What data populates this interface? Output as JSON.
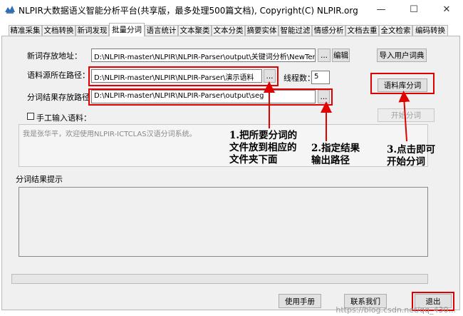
{
  "window": {
    "title": "NLPIR大数据语义智能分析平台(共享版，最多处理500篇文档), Copyright(C) NLPIR.org",
    "minimize": "—",
    "restore": "☐",
    "close": "✕"
  },
  "tabs": [
    "精准采集",
    "文档转换",
    "新词发现",
    "批量分词",
    "语言统计",
    "文本聚类",
    "文本分类",
    "摘要实体",
    "智能过滤",
    "情感分析",
    "文档去重",
    "全文检索",
    "编码转换"
  ],
  "form": {
    "newword_label": "新词存放地址：",
    "newword_path": "D:\\NLPIR-master\\NLPIR\\NLPIR-Parser\\output\\关键词分析\\NewTermlist.txt",
    "browse": "...",
    "edit_button": "编辑",
    "import_dict_button": "导入用户词典",
    "corpus_label": "语料源所在路径：",
    "corpus_path": "D:\\NLPIR-master\\NLPIR\\NLPIR-Parser\\演示语料",
    "threads_label": "线程数：",
    "threads_value": "5",
    "segment_corpus_button": "语料库分词",
    "result_label": "分词结果存放路径：",
    "result_path": "D:\\NLPIR-master\\NLPIR\\NLPIR-Parser\\output\\seg",
    "manual_label": "手工输入语料：",
    "start_segment_button": "开始分词",
    "manual_text": "我是张华平，欢迎使用NLPIR-ICTCLAS汉语分词系统。",
    "result_hint_label": "分词结果提示"
  },
  "annotations": {
    "a1": [
      "1.把所要分词的",
      "文件放到相应的",
      "文件夹下面"
    ],
    "a2": [
      "2.指定结果",
      "输出路径"
    ],
    "a3": [
      "3.点击即可",
      "开始分词"
    ]
  },
  "bottom": {
    "manual_button": "使用手册",
    "contact_button": "联系我们",
    "exit_button": "退出"
  },
  "watermark": "https://blog.csdn.net/qq_430...",
  "colors": {
    "annotation_red": "#e00000",
    "panel_bg": "#f0f0f0"
  }
}
